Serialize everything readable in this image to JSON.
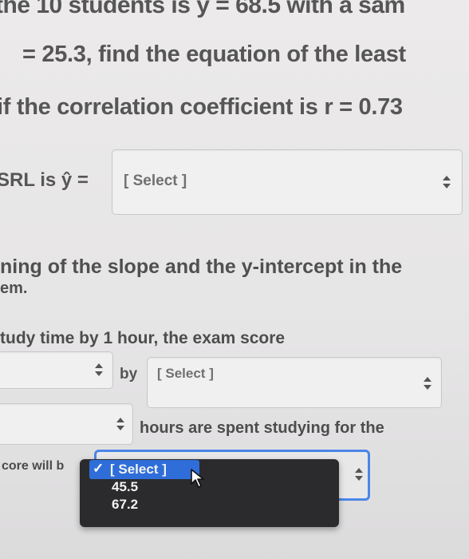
{
  "question": {
    "line1": "the 10 students is ȳ = 68.5 with a sam",
    "line2": "= 25.3, find the equation of the least",
    "line3": "if the correlation coefficient is r = 0.73"
  },
  "lsrl": {
    "label": "SRL is ŷ =",
    "select_value": "[ Select ]"
  },
  "part_b": {
    "line1": "ning of the slope and the y-intercept in the",
    "line2": "em."
  },
  "slope_sentence": {
    "text": "tudy time by 1 hour, the exam score",
    "by_label": "by",
    "select_value": "[ Select ]"
  },
  "intercept_sentence": {
    "text": "hours are spent studying for the",
    "prefix": "core will b"
  },
  "dropdown": {
    "options": [
      "[ Select ]",
      "45.5",
      "67.2"
    ],
    "selected_index": 0
  }
}
